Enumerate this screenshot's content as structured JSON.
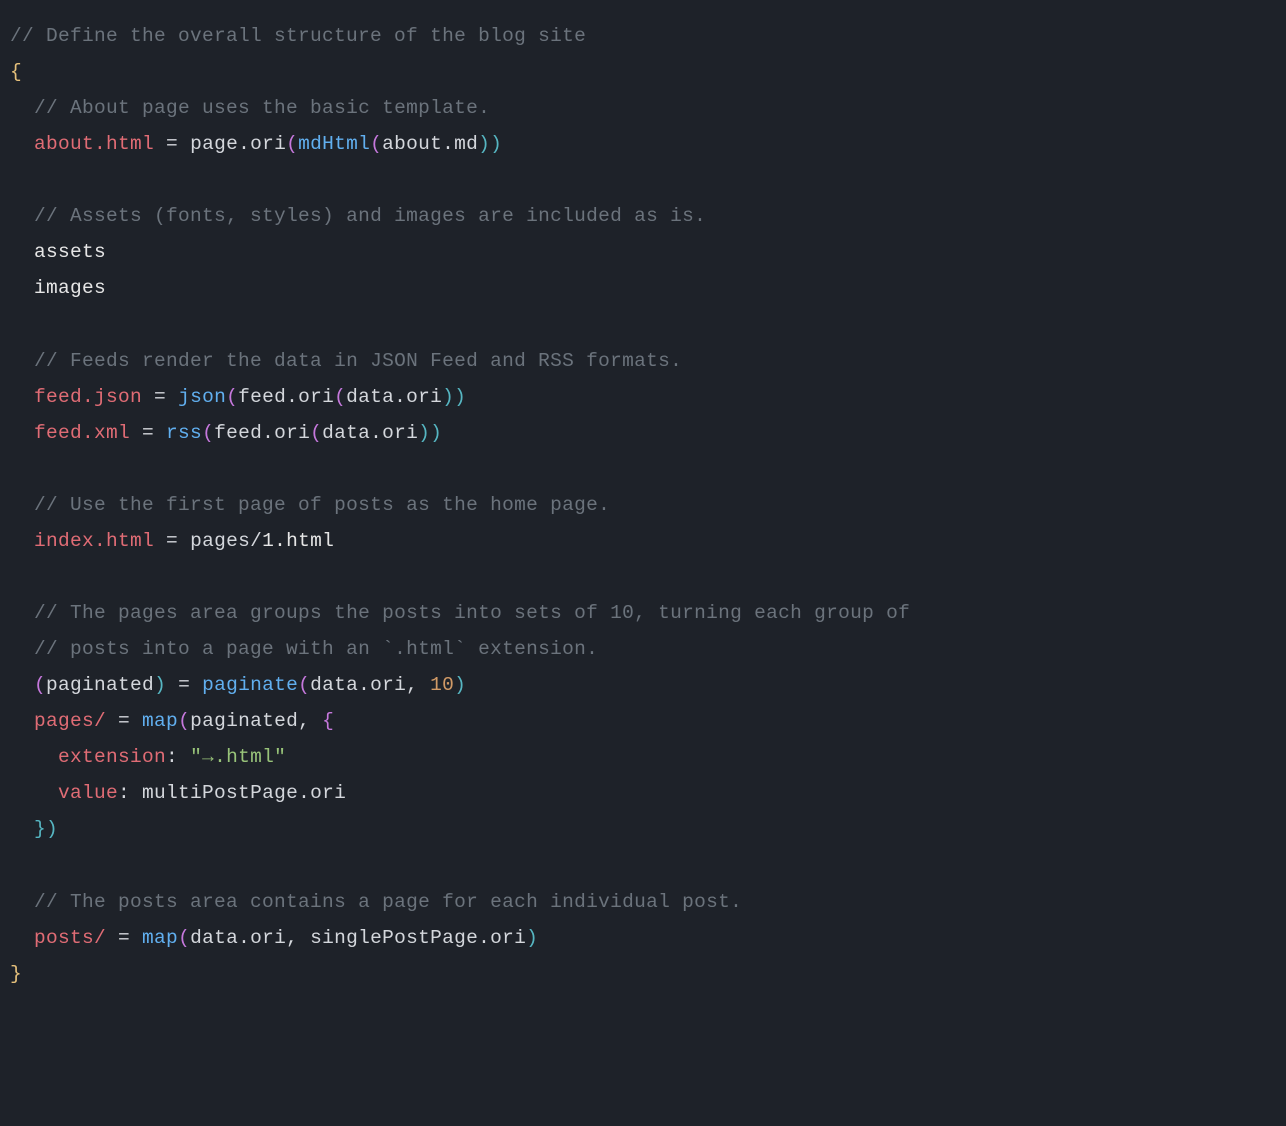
{
  "code": {
    "c1": "// Define the overall structure of the blog site",
    "obrace": "{",
    "c2": "// About page uses the basic template.",
    "about_key": "about.html",
    "eq": " = ",
    "page_ori": "page.ori",
    "lp": "(",
    "mdHtml": "mdHtml",
    "about_md": "about.md",
    "rp": ")",
    "c3": "// Assets (fonts, styles) and images are included as is.",
    "assets": "assets",
    "images": "images",
    "c4": "// Feeds render the data in JSON Feed and RSS formats.",
    "feed_json": "feed.json",
    "json_fn": "json",
    "feed_ori": "feed.ori",
    "data_ori": "data.ori",
    "feed_xml": "feed.xml",
    "rss_fn": "rss",
    "c5": "// Use the first page of posts as the home page.",
    "index_html": "index.html",
    "pages_slash": "pages/",
    "one_html": "1.html",
    "c6a": "// The pages area groups the posts into sets of 10, turning each group of",
    "c6b": "// posts into a page with an `.html` extension.",
    "paginated": "paginated",
    "paginate": "paginate",
    "comma": ", ",
    "ten": "10",
    "map_fn": "map",
    "obrace2": "{",
    "extension_key": "extension",
    "colon": ": ",
    "ext_str": "\"→.html\"",
    "value_key": "value",
    "multiPost": "multiPostPage.ori",
    "cbrace2": "}",
    "c7": "// The posts area contains a page for each individual post.",
    "posts_slash": "posts/",
    "singlePost": "singlePostPage.ori",
    "cbrace": "}"
  }
}
